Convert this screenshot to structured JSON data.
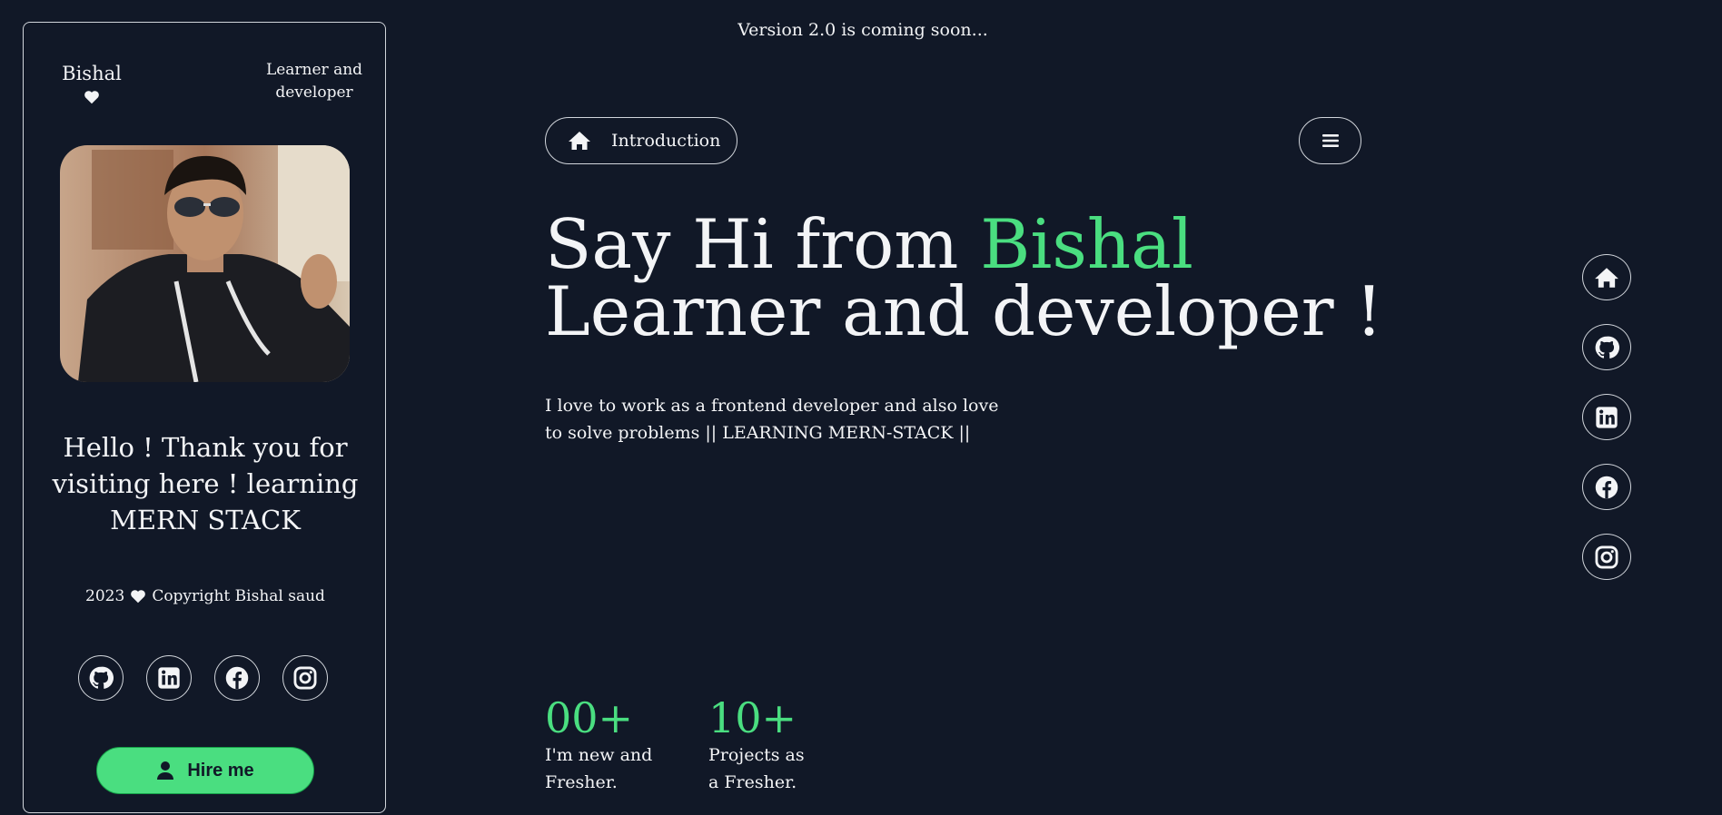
{
  "announcement": "Version 2.0 is coming soon...",
  "card": {
    "brand_name": "Bishal",
    "role": "Learner and developer",
    "hello": "Hello ! Thank you for visiting here ! learning MERN STACK",
    "copyright_year": "2023",
    "copyright_text": "Copyright Bishal saud",
    "socials": [
      {
        "icon": "github-icon"
      },
      {
        "icon": "linkedin-icon"
      },
      {
        "icon": "facebook-icon"
      },
      {
        "icon": "instagram-icon"
      }
    ],
    "hire_label": "Hire me"
  },
  "nav": {
    "intro_label": "Introduction",
    "menu_icon": "hamburger-menu-icon"
  },
  "hero": {
    "headline_part1": "Say Hi from ",
    "headline_accent": "Bishal",
    "headline_part2": " Learner and developer !",
    "description": "I love to work as a frontend developer and also love to solve problems || LEARNING MERN-STACK ||"
  },
  "stats": [
    {
      "value": "00+",
      "label": "I'm new and Fresher."
    },
    {
      "value": "10+",
      "label": "Projects as a Fresher."
    }
  ],
  "side_nav": [
    {
      "icon": "home-icon"
    },
    {
      "icon": "github-icon"
    },
    {
      "icon": "linkedin-icon"
    },
    {
      "icon": "facebook-icon"
    },
    {
      "icon": "instagram-icon"
    }
  ],
  "colors": {
    "background": "#111827",
    "accent": "#4ade80",
    "text": "#f3f4f6",
    "border": "#d1d5db"
  }
}
